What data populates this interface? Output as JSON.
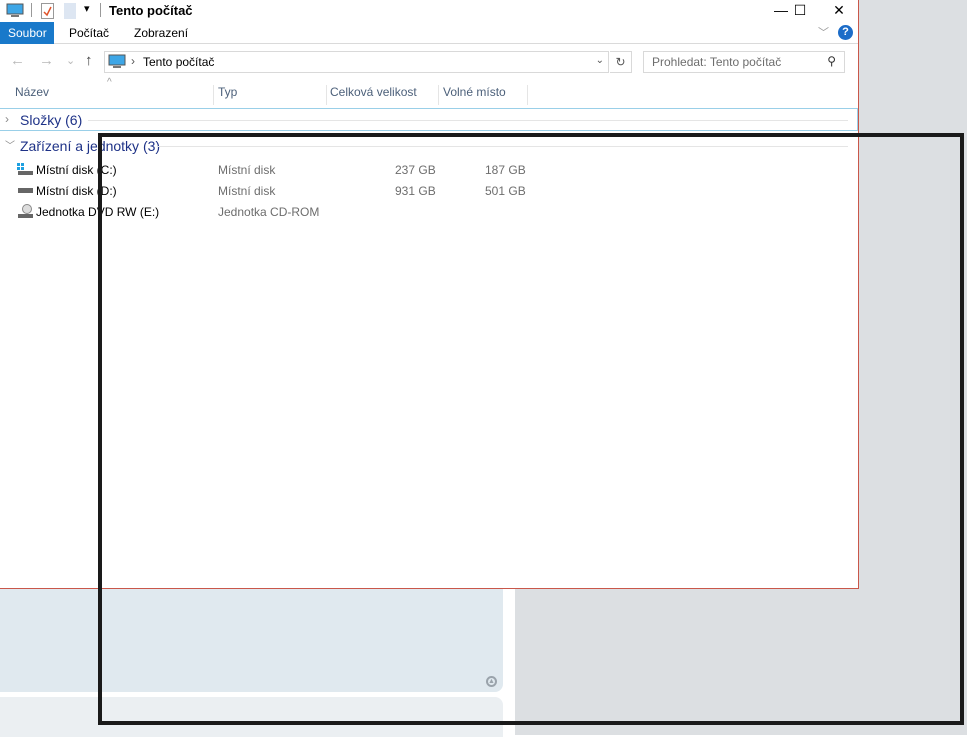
{
  "window": {
    "title": "Tento počítač",
    "minimize": "—",
    "maximize": "☐",
    "close": "✕"
  },
  "ribbon": {
    "tabs": [
      "Soubor",
      "Počítač",
      "Zobrazení"
    ],
    "help": "?",
    "expand": "﹀"
  },
  "nav": {
    "back": "←",
    "forward": "→",
    "recent": "⌄",
    "up": "↑",
    "refresh": "↻"
  },
  "address": {
    "path": "Tento počítač",
    "separator": "›"
  },
  "search": {
    "placeholder": "Prohledat: Tento počítač"
  },
  "columns": [
    "Název",
    "Typ",
    "Celková velikost",
    "Volné místo"
  ],
  "groups": [
    {
      "label": "Složky (6)",
      "expanded": false
    },
    {
      "label": "Zařízení a jednotky (3)",
      "expanded": true
    }
  ],
  "drives": [
    {
      "name": "Místní disk (C:)",
      "type": "Místní disk",
      "total": "237 GB",
      "free": "187 GB",
      "icon": "windows-drive-icon"
    },
    {
      "name": "Místní disk (D:)",
      "type": "Místní disk",
      "total": "931 GB",
      "free": "501 GB",
      "icon": "hard-drive-icon"
    },
    {
      "name": "Jednotka DVD RW (E:)",
      "type": "Jednotka CD-ROM",
      "total": "",
      "free": "",
      "icon": "dvd-drive-icon"
    }
  ]
}
